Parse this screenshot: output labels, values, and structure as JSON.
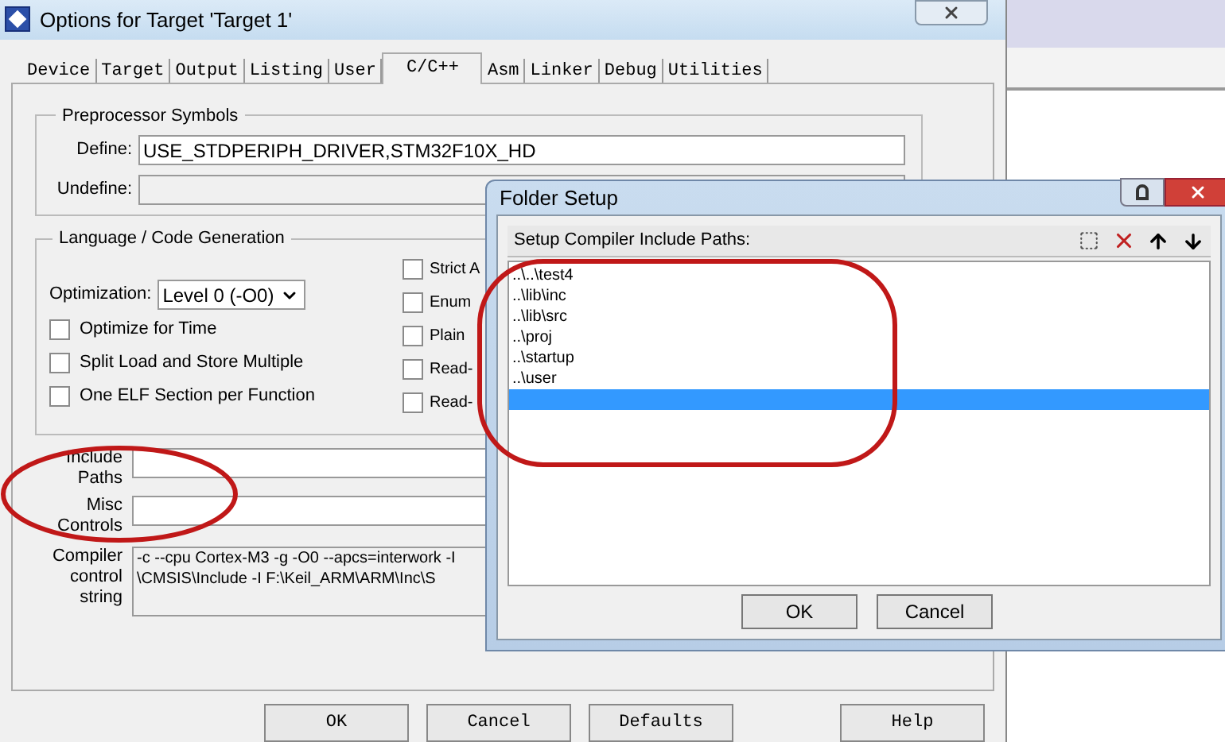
{
  "main_dialog": {
    "title": "Options for Target 'Target 1'",
    "tabs": [
      {
        "label": "Device",
        "selected": false
      },
      {
        "label": "Target",
        "selected": false
      },
      {
        "label": "Output",
        "selected": false
      },
      {
        "label": "Listing",
        "selected": false
      },
      {
        "label": "User",
        "selected": false
      },
      {
        "label": "C/C++",
        "selected": true
      },
      {
        "label": "Asm",
        "selected": false
      },
      {
        "label": "Linker",
        "selected": false
      },
      {
        "label": "Debug",
        "selected": false
      },
      {
        "label": "Utilities",
        "selected": false
      }
    ],
    "preprocessor": {
      "title": "Preprocessor Symbols",
      "define_label": "Define:",
      "define_value": "USE_STDPERIPH_DRIVER,STM32F10X_HD",
      "undefine_label": "Undefine:"
    },
    "language": {
      "title": "Language / Code Generation",
      "optimization_label": "Optimization:",
      "optimization_value": "Level 0 (-O0)",
      "options_left": [
        {
          "label": "Optimize for Time",
          "checked": false
        },
        {
          "label": "Split Load and Store Multiple",
          "checked": false
        },
        {
          "label": "One ELF Section per Function",
          "checked": false
        }
      ],
      "options_right": [
        {
          "label": "Strict A",
          "checked": false
        },
        {
          "label": "Enum",
          "checked": false
        },
        {
          "label": "Plain",
          "checked": false
        },
        {
          "label": "Read-",
          "checked": false
        },
        {
          "label": "Read-",
          "checked": false
        }
      ]
    },
    "include_paths_label": "Include Paths",
    "misc_controls_label": "Misc Controls",
    "compiler_string_label": "Compiler control string",
    "compiler_string_lines": [
      "-c --cpu Cortex-M3 -g -O0 --apcs=interwork -I",
      "\\CMSIS\\Include -I F:\\Keil_ARM\\ARM\\Inc\\S"
    ],
    "buttons": [
      "OK",
      "Cancel",
      "Defaults",
      "Help"
    ]
  },
  "folder_dialog": {
    "title": "Folder Setup",
    "list_label": "Setup Compiler Include Paths:",
    "paths": [
      {
        "text": "..\\..\\test4",
        "selected": false
      },
      {
        "text": "..\\lib\\inc",
        "selected": false
      },
      {
        "text": "..\\lib\\src",
        "selected": false
      },
      {
        "text": "..\\proj",
        "selected": false
      },
      {
        "text": "..\\startup",
        "selected": false
      },
      {
        "text": "..\\user",
        "selected": false
      },
      {
        "selected": true
      }
    ],
    "buttons": [
      "OK",
      "Cancel"
    ]
  }
}
